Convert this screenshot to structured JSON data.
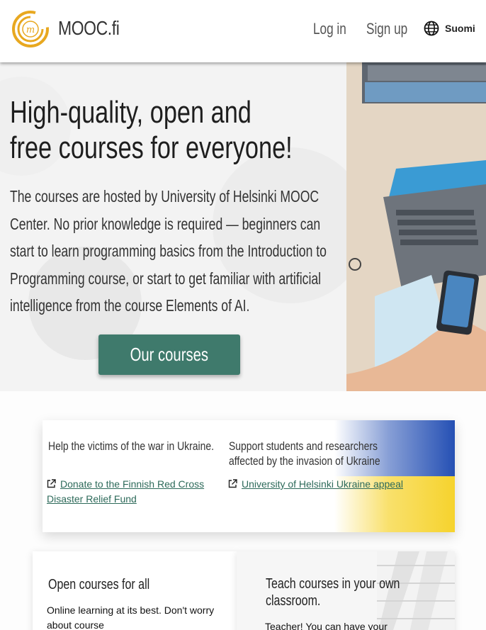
{
  "header": {
    "logo_text": "MOOC.fi",
    "nav": {
      "login": "Log in",
      "signup": "Sign up"
    },
    "language": {
      "label": "Suomi",
      "icon": "globe-icon"
    }
  },
  "hero": {
    "title": "High-quality, open and free courses for everyone!",
    "description": "The courses are hosted by University of Helsinki MOOC Center. No prior knowledge is required — beginners can start to learn programming basics from the Introduction to Programming course, or start to get familiar with artificial intelligence from the course Elements of AI.",
    "cta_label": "Our courses"
  },
  "ukraine": {
    "left_heading": "Help the victims of the war in Ukraine.",
    "left_link": "Donate to the Finnish Red Cross Disaster Relief Fund",
    "right_heading": "Support students and researchers affected by the invasion of Ukraine",
    "right_link": "University of Helsinki Ukraine appeal",
    "link_icon": "external-link-icon"
  },
  "cards": {
    "open": {
      "title": "Open courses for all",
      "text": "Online learning at its best. Don't worry about course"
    },
    "teach": {
      "title": "Teach courses in your own classroom.",
      "text": "Teacher! You can have your"
    }
  },
  "colors": {
    "accent": "#3f7a6c",
    "link": "#2d6a5a",
    "logo": "#e8a820",
    "flag_blue": "#2550b4",
    "flag_yellow": "#f6d32d"
  }
}
